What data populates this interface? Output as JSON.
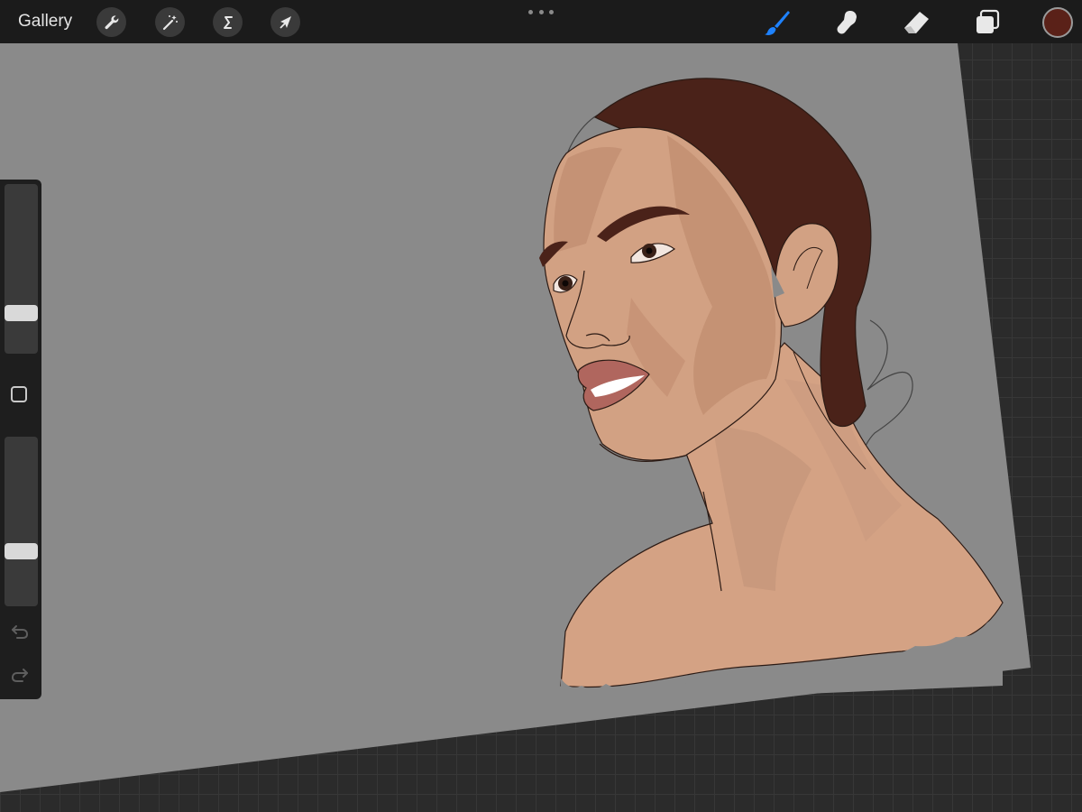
{
  "topbar": {
    "gallery_label": "Gallery",
    "left_tools": [
      {
        "icon": "wrench-icon",
        "name": "actions-button"
      },
      {
        "icon": "magic-wand-icon",
        "name": "adjustments-button"
      },
      {
        "icon": "selection-s-icon",
        "name": "selection-button"
      },
      {
        "icon": "arrow-cursor-icon",
        "name": "transform-button"
      }
    ],
    "right_tools": [
      {
        "icon": "brush-icon",
        "name": "paint-tool-button",
        "active": true
      },
      {
        "icon": "smudge-finger-icon",
        "name": "smudge-tool-button",
        "active": false
      },
      {
        "icon": "eraser-icon",
        "name": "eraser-tool-button",
        "active": false
      },
      {
        "icon": "layers-icon",
        "name": "layers-button",
        "active": false
      }
    ],
    "current_color": "#5a2118"
  },
  "sidebar": {
    "brush_size_level": 0.2,
    "opacity_level": 0.3,
    "modify_icon": "square-modify-icon",
    "undo_icon": "undo-icon",
    "redo_icon": "redo-icon"
  },
  "colors": {
    "accent": "#1e82ff",
    "canvas": "#8a8a8a",
    "skin": "#d3a283",
    "hair": "#4a2219",
    "lips": "#b0665e"
  }
}
